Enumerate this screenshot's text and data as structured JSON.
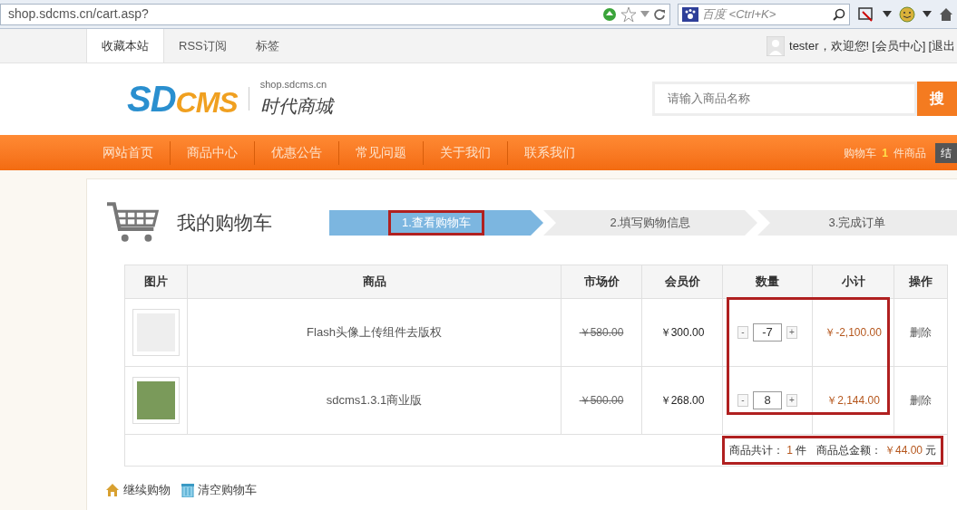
{
  "browser": {
    "url": "shop.sdcms.cn/cart.asp?",
    "search_placeholder": "百度 <Ctrl+K>"
  },
  "topbar": {
    "links": [
      {
        "label": "收藏本站",
        "selected": true
      },
      {
        "label": "RSS订阅",
        "selected": false
      },
      {
        "label": "标签",
        "selected": false
      }
    ],
    "user": "tester，欢迎您!",
    "user_links": [
      "[会员中心]",
      "[退出"
    ]
  },
  "header": {
    "logo_left": "SD",
    "logo_right": "CMS",
    "site_url": "shop.sdcms.cn",
    "site_name": "时代商城",
    "search_placeholder": "请输入商品名称",
    "search_button": "搜"
  },
  "nav": {
    "items": [
      "网站首页",
      "商品中心",
      "优惠公告",
      "常见问题",
      "关于我们",
      "联系我们"
    ],
    "cart_label": "购物车",
    "cart_count": "1",
    "cart_unit": "件商品",
    "checkout": "结"
  },
  "cart": {
    "title": "我的购物车",
    "steps": [
      {
        "label": "1.查看购物车",
        "selected": true,
        "highlighted": true
      },
      {
        "label": "2.填写购物信息",
        "selected": false,
        "highlighted": false
      },
      {
        "label": "3.完成订单",
        "selected": false,
        "highlighted": false
      }
    ],
    "table": {
      "columns": [
        "图片",
        "商品",
        "市场价",
        "会员价",
        "数量",
        "小计",
        "操作"
      ],
      "quantity_subtotal_highlighted": true,
      "rows": [
        {
          "name": "Flash头像上传组件去版权",
          "market_price": "￥580.00",
          "member_price": "￥300.00",
          "minus": "-",
          "quantity": "-7",
          "plus": "+",
          "subtotal": "￥-2,100.00",
          "action": "删除"
        },
        {
          "name": "sdcms1.3.1商业版",
          "market_price": "￥500.00",
          "member_price": "￥268.00",
          "minus": "-",
          "quantity": "8",
          "plus": "+",
          "subtotal": "￥2,144.00",
          "action": "删除"
        }
      ]
    },
    "summary": {
      "count_label": "商品共计：",
      "count": "1",
      "count_unit": "件",
      "total_label": "商品总金额：",
      "total": "￥44.00",
      "total_unit": "元",
      "highlighted": true
    },
    "footer_links": [
      "继续购物",
      "清空购物车"
    ]
  }
}
